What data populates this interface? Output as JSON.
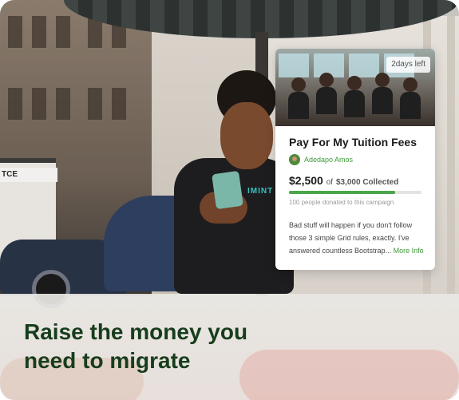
{
  "background": {
    "storefront_sign": "TCE",
    "shirt_text": "IMINT"
  },
  "campaign_card": {
    "time_left": "2days left",
    "title": "Pay For My Tuition Fees",
    "author": "Adedapo Amos",
    "raised": "$2,500",
    "goal_prefix": "of",
    "goal": "$3,000 Collected",
    "progress_fraction": 0.8,
    "donors_text": "100 people donated to this campaign",
    "description": "Bad stuff will happen if you don't follow those 3 simple Grid rules, exactly. I've answered countless Bootstrap...",
    "more_link": "More Info",
    "accent_color": "#4aa64a"
  },
  "headline": "Raise the money you need to migrate"
}
